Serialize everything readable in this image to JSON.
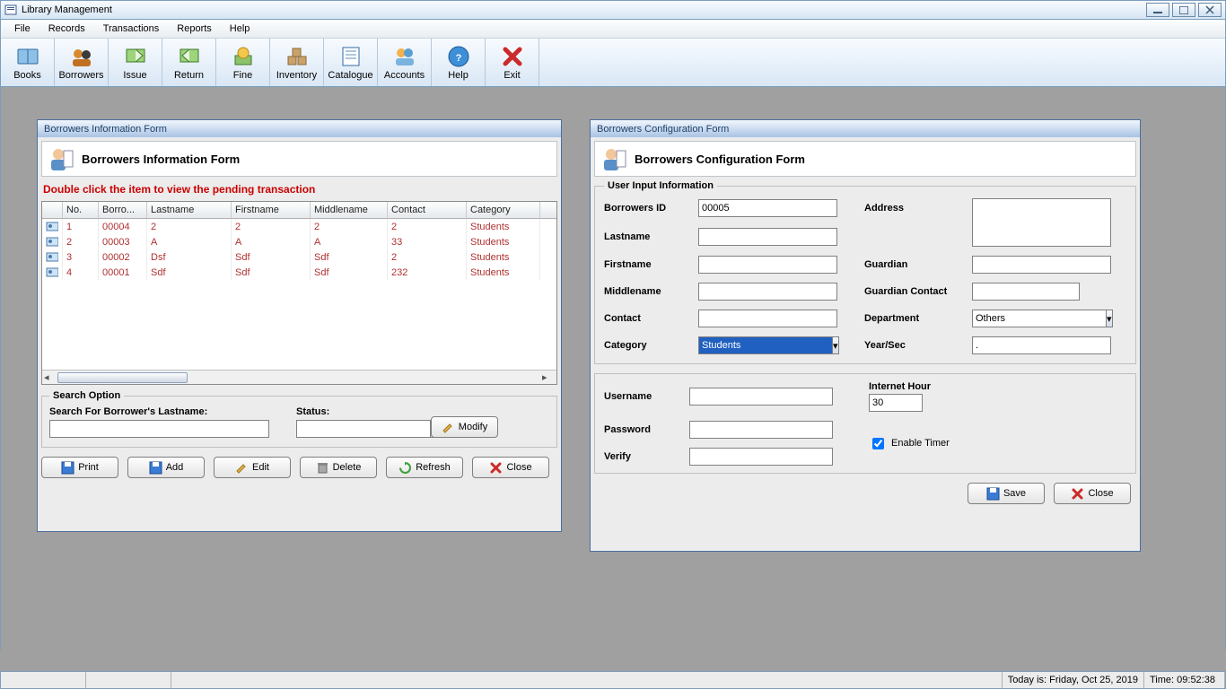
{
  "window": {
    "title": "Library Management"
  },
  "menu": {
    "items": [
      "File",
      "Records",
      "Transactions",
      "Reports",
      "Help"
    ]
  },
  "toolbar": [
    {
      "label": "Books",
      "icon": "book"
    },
    {
      "label": "Borrowers",
      "icon": "people"
    },
    {
      "label": "Issue",
      "icon": "issue"
    },
    {
      "label": "Return",
      "icon": "return"
    },
    {
      "label": "Fine",
      "icon": "fine"
    },
    {
      "label": "Inventory",
      "icon": "inventory"
    },
    {
      "label": "Catalogue",
      "icon": "catalogue"
    },
    {
      "label": "Accounts",
      "icon": "accounts"
    },
    {
      "label": "Help",
      "icon": "help"
    },
    {
      "label": "Exit",
      "icon": "exit"
    }
  ],
  "form1": {
    "title": "Borrowers Information Form",
    "header": "Borrowers Information Form",
    "hint": "Double click the item to view the pending transaction",
    "columns": [
      "No.",
      "Borro...",
      "Lastname",
      "Firstname",
      "Middlename",
      "Contact",
      "Category"
    ],
    "rows": [
      {
        "no": "1",
        "bid": "00004",
        "ln": "2",
        "fn": "2",
        "mn": "2",
        "ct": "2",
        "cat": "Students"
      },
      {
        "no": "2",
        "bid": "00003",
        "ln": "A",
        "fn": "A",
        "mn": "A",
        "ct": "33",
        "cat": "Students"
      },
      {
        "no": "3",
        "bid": "00002",
        "ln": "Dsf",
        "fn": "Sdf",
        "mn": "Sdf",
        "ct": "2",
        "cat": "Students"
      },
      {
        "no": "4",
        "bid": "00001",
        "ln": "Sdf",
        "fn": "Sdf",
        "mn": "Sdf",
        "ct": "232",
        "cat": "Students"
      }
    ],
    "search": {
      "legend": "Search Option",
      "searchLabel": "Search For Borrower's Lastname:",
      "searchValue": "",
      "statusLabel": "Status:",
      "statusValue": "",
      "modifyLabel": "Modify"
    },
    "buttons": {
      "print": "Print",
      "add": "Add",
      "edit": "Edit",
      "delete": "Delete",
      "refresh": "Refresh",
      "close": "Close"
    }
  },
  "form2": {
    "title": "Borrowers Configuration Form",
    "header": "Borrowers Configuration Form",
    "legend": "User Input Information",
    "labels": {
      "borrowersId": "Borrowers ID",
      "lastname": "Lastname",
      "firstname": "Firstname",
      "middlename": "Middlename",
      "contact": "Contact",
      "category": "Category",
      "address": "Address",
      "guardian": "Guardian",
      "guardianContact": "Guardian Contact",
      "department": "Department",
      "yearSec": "Year/Sec",
      "username": "Username",
      "password": "Password",
      "verify": "Verify",
      "internetHour": "Internet Hour",
      "enableTimer": "Enable Timer"
    },
    "values": {
      "borrowersId": "00005",
      "lastname": "",
      "firstname": "",
      "middlename": "",
      "contact": "",
      "category": "Students",
      "address": "",
      "guardian": "",
      "guardianContact": "",
      "department": "Others",
      "yearSec": ".",
      "username": "",
      "password": "",
      "verify": "",
      "internetHour": "30",
      "enableTimer": true
    },
    "buttons": {
      "save": "Save",
      "close": "Close"
    }
  },
  "statusbar": {
    "date": "Today is: Friday, Oct 25, 2019",
    "time": "Time: 09:52:38"
  }
}
